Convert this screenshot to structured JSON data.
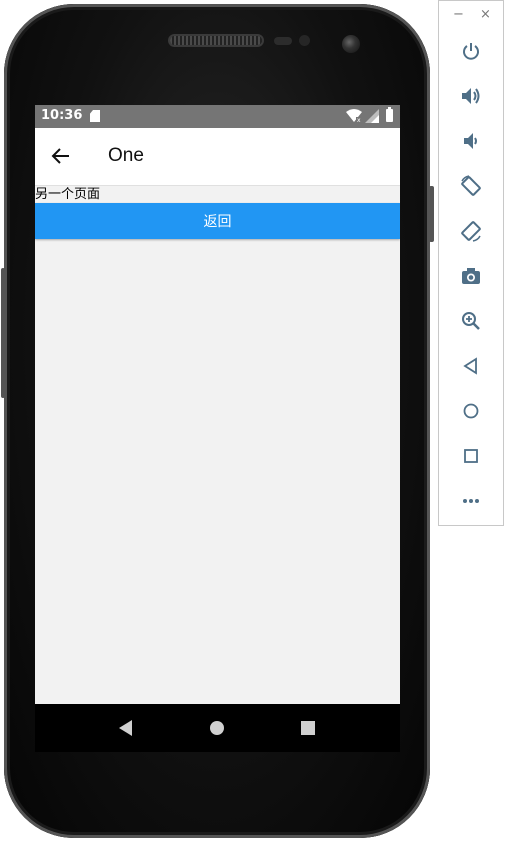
{
  "status_bar": {
    "time": "10:36",
    "icons": [
      "sd-card-icon",
      "wifi-icon",
      "signal-icon",
      "battery-icon"
    ]
  },
  "app_bar": {
    "title": "One",
    "back_icon": "arrow-back-icon"
  },
  "content": {
    "text": "另一个页面",
    "button_label": "返回"
  },
  "nav_bar": {
    "buttons": [
      "back-triangle-icon",
      "home-circle-icon",
      "recent-square-icon"
    ]
  },
  "emulator_toolbar": {
    "minimize_label": "−",
    "close_label": "×",
    "buttons": [
      "power-icon",
      "volume-up-icon",
      "volume-down-icon",
      "rotate-left-icon",
      "rotate-right-icon",
      "screenshot-icon",
      "zoom-icon",
      "back-icon",
      "home-icon",
      "overview-icon",
      "more-icon"
    ]
  },
  "colors": {
    "accent": "#2196f3",
    "status_bar": "#757575",
    "screen_background": "#f2f2f2",
    "toolbar_icon": "#4f6f87"
  }
}
